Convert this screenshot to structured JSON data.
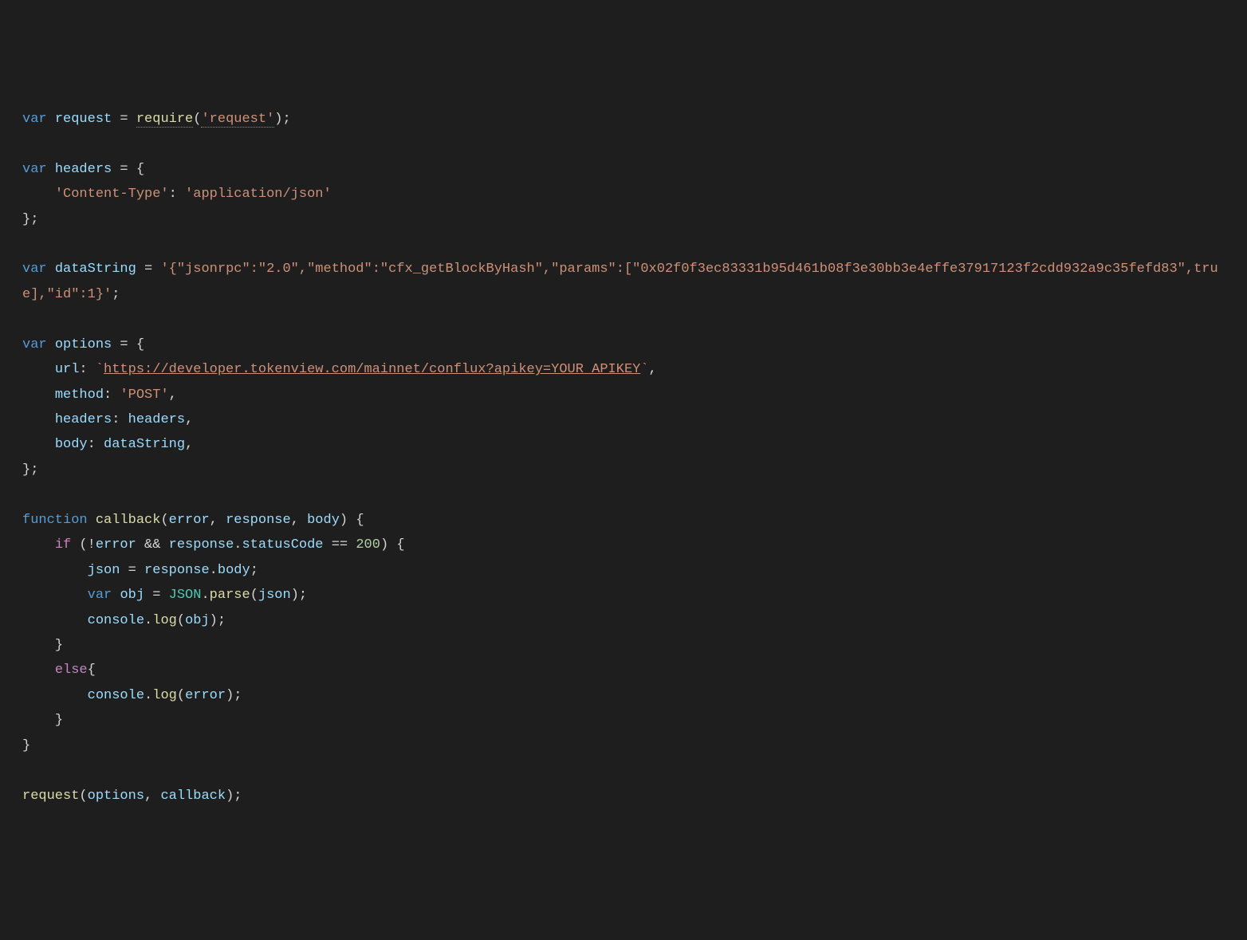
{
  "code": {
    "l1": {
      "var": "var",
      "request": "request",
      "eq": " = ",
      "require": "require",
      "lp": "(",
      "str": "'request'",
      "rp": ")",
      "semi": ";"
    },
    "l3": {
      "var": "var",
      "headers": "headers",
      "eq": " = {"
    },
    "l4": {
      "indent": "    ",
      "key": "'Content-Type'",
      "colon": ": ",
      "val": "'application/json'"
    },
    "l5": {
      "close": "};"
    },
    "l7": {
      "var": "var",
      "name": "dataString",
      "eq": " = ",
      "str": "'{\"jsonrpc\":\"2.0\",\"method\":\"cfx_getBlockByHash\",\"params\":[\"0x02f0f3ec83331b95d461b08f3e30bb3e4effe37917123f2cdd932a9c35fefd83\",true],\"id\":1}'",
      "semi": ";"
    },
    "l9": {
      "var": "var",
      "name": "options",
      "eq": " = {"
    },
    "l10": {
      "indent": "    ",
      "key": "url",
      "colon": ": ",
      "tick1": "`",
      "url": "https://developer.tokenview.com/mainnet/conflux?apikey=YOUR_APIKEY",
      "tick2": "`",
      "comma": ","
    },
    "l11": {
      "indent": "    ",
      "key": "method",
      "colon": ": ",
      "val": "'POST'",
      "comma": ","
    },
    "l12": {
      "indent": "    ",
      "key": "headers",
      "colon": ": ",
      "val": "headers",
      "comma": ","
    },
    "l13": {
      "indent": "    ",
      "key": "body",
      "colon": ": ",
      "val": "dataString",
      "comma": ","
    },
    "l14": {
      "close": "};"
    },
    "l16": {
      "fn": "function",
      "name": "callback",
      "lp": "(",
      "p1": "error",
      "c1": ", ",
      "p2": "response",
      "c2": ", ",
      "p3": "body",
      "rp": ") {"
    },
    "l17": {
      "indent": "    ",
      "if": "if",
      "cond_open": " (!",
      "err": "error",
      "and": " && ",
      "resp": "response",
      "dot": ".",
      "sc": "statusCode",
      "eq": " == ",
      "num": "200",
      "close": ") {"
    },
    "l18": {
      "indent": "        ",
      "json": "json",
      "eq": " = ",
      "resp": "response",
      "dot": ".",
      "body": "body",
      "semi": ";"
    },
    "l19": {
      "indent": "        ",
      "var": "var",
      "obj": "obj",
      "eq": " = ",
      "JSON": "JSON",
      "dot": ".",
      "parse": "parse",
      "lp": "(",
      "arg": "json",
      "rp": ");"
    },
    "l20": {
      "indent": "        ",
      "console": "console",
      "dot": ".",
      "log": "log",
      "lp": "(",
      "arg": "obj",
      "rp": ");"
    },
    "l21": {
      "indent": "    ",
      "close": "}"
    },
    "l22": {
      "indent": "    ",
      "else": "else",
      "open": "{"
    },
    "l23": {
      "indent": "        ",
      "console": "console",
      "dot": ".",
      "log": "log",
      "lp": "(",
      "arg": "error",
      "rp": ");"
    },
    "l24": {
      "indent": "    ",
      "close": "}"
    },
    "l25": {
      "close": "}"
    },
    "l27": {
      "request": "request",
      "lp": "(",
      "a1": "options",
      "c": ", ",
      "a2": "callback",
      "rp": ");"
    }
  }
}
